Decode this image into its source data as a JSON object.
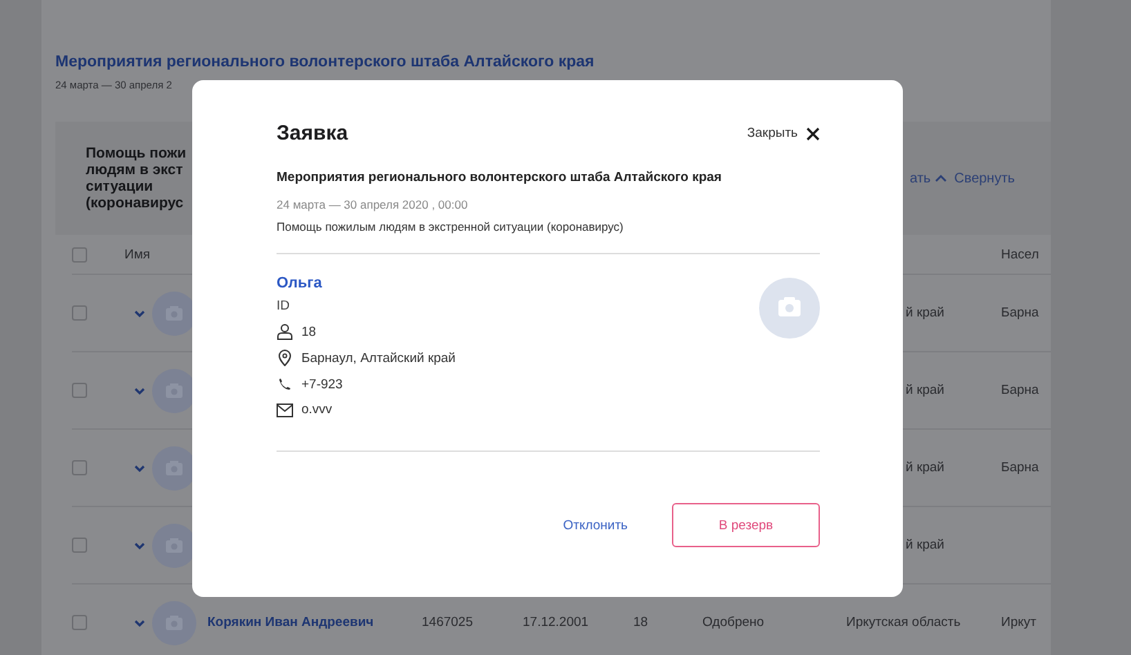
{
  "page": {
    "title": "Мероприятия регионального волонтерского штаба Алтайского края",
    "date": "24 марта — 30 апреля 2"
  },
  "activity": {
    "title_lines": [
      "Помощь пожи",
      "людям в экст",
      "ситуации",
      "(коронавирус"
    ],
    "action_fragment": "ать",
    "collapse": "Свернуть"
  },
  "table": {
    "header": {
      "checked": false,
      "name": "Имя",
      "column_8": "Насел"
    },
    "rows": [
      {
        "checked": false,
        "expanded": false,
        "region": "й край",
        "city": "Барна"
      },
      {
        "checked": false,
        "expanded": false,
        "region": "й край",
        "city": "Барна"
      },
      {
        "checked": false,
        "expanded": false,
        "region": "й край",
        "city": "Барна"
      },
      {
        "checked": false,
        "expanded": false,
        "region": "й край"
      },
      {
        "checked": false,
        "expanded": false,
        "name": "Корякин Иван Андреевич",
        "id": "1467025",
        "birth_date": "17.12.2001",
        "age": "18",
        "status": "Одобрено",
        "region": "Иркутская область",
        "city": "Иркут"
      }
    ]
  },
  "modal": {
    "title": "Заявка",
    "close_label": "Закрыть",
    "event_title": "Мероприятия регионального волонтерского штаба Алтайского края",
    "event_date": "24 марта — 30 апреля 2020 , 00:00",
    "event_description": "Помощь пожилым людям в экстренной ситуации (коронавирус)",
    "person": {
      "name": "Ольга",
      "id_label": "ID",
      "details": [
        {
          "kind": "age",
          "text": "18"
        },
        {
          "kind": "location",
          "text": "Барнаул, Алтайский край"
        },
        {
          "kind": "phone",
          "text": "+7-923"
        },
        {
          "kind": "email",
          "text": "o.vvv"
        }
      ]
    },
    "buttons": {
      "reject": "Отклонить",
      "reserve": "В резерв"
    }
  }
}
